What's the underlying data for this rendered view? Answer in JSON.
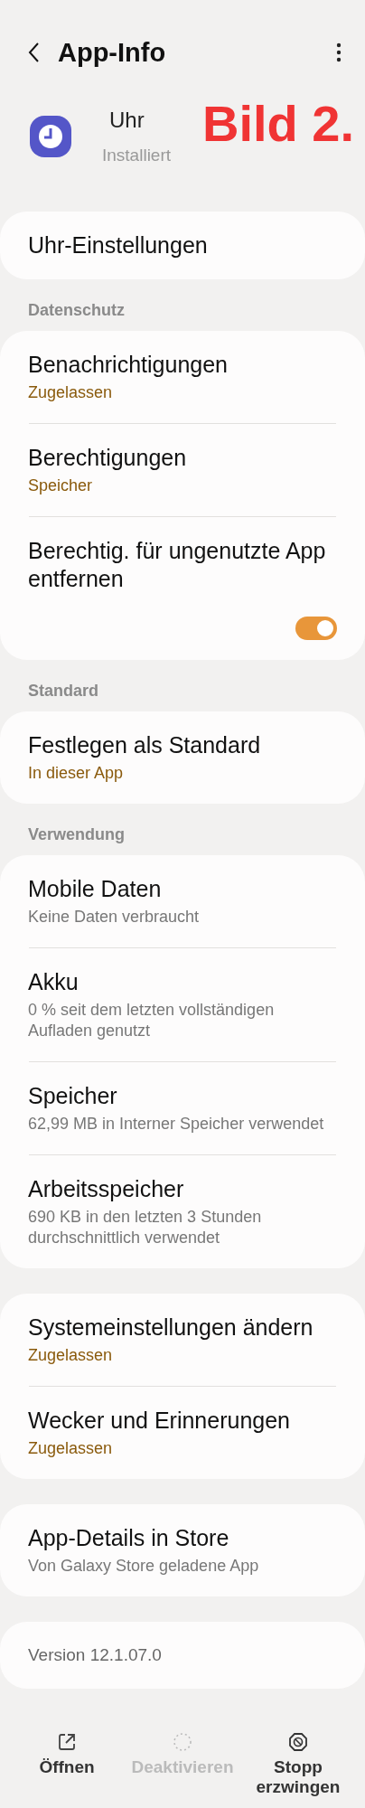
{
  "header": {
    "title": "App-Info"
  },
  "app": {
    "name": "Uhr",
    "status": "Installiert"
  },
  "annotation": "Bild 2.",
  "groups": [
    {
      "items": [
        {
          "kind": "link",
          "title": "Uhr-Einstellungen"
        }
      ]
    },
    {
      "header": "Datenschutz",
      "items": [
        {
          "kind": "status",
          "title": "Benachrichtigungen",
          "subtitle": "Zugelassen"
        },
        {
          "kind": "status",
          "title": "Berechtigungen",
          "subtitle": "Speicher"
        },
        {
          "kind": "toggle",
          "title": "Berechtig. für ungenutzte App entfernen",
          "on": true
        }
      ]
    },
    {
      "header": "Standard",
      "items": [
        {
          "kind": "status",
          "title": "Festlegen als Standard",
          "subtitle": "In dieser App"
        }
      ]
    },
    {
      "header": "Verwendung",
      "items": [
        {
          "kind": "info",
          "title": "Mobile Daten",
          "subtitle": "Keine Daten verbraucht"
        },
        {
          "kind": "info",
          "title": "Akku",
          "subtitle": "0 % seit dem letzten vollständigen Aufladen genutzt"
        },
        {
          "kind": "info",
          "title": "Speicher",
          "subtitle": "62,99 MB in Interner Speicher verwendet"
        },
        {
          "kind": "info",
          "title": "Arbeitsspeicher",
          "subtitle": "690 KB in den letzten 3 Stunden durchschnittlich verwendet"
        }
      ]
    },
    {
      "items": [
        {
          "kind": "status",
          "title": "Systemeinstellungen ändern",
          "subtitle": "Zugelassen"
        },
        {
          "kind": "status",
          "title": "Wecker und Erinnerungen",
          "subtitle": "Zugelassen"
        }
      ]
    },
    {
      "items": [
        {
          "kind": "info",
          "title": "App-Details in Store",
          "subtitle": "Von Galaxy Store geladene App"
        }
      ]
    },
    {
      "items": [
        {
          "kind": "version",
          "title": "Version 12.1.07.0"
        }
      ]
    }
  ],
  "actions": [
    {
      "kind": "open",
      "label": "Öffnen",
      "disabled": false
    },
    {
      "kind": "disable",
      "label": "Deaktivieren",
      "disabled": true
    },
    {
      "kind": "stop",
      "label": "Stopp erzwingen",
      "disabled": false
    }
  ]
}
